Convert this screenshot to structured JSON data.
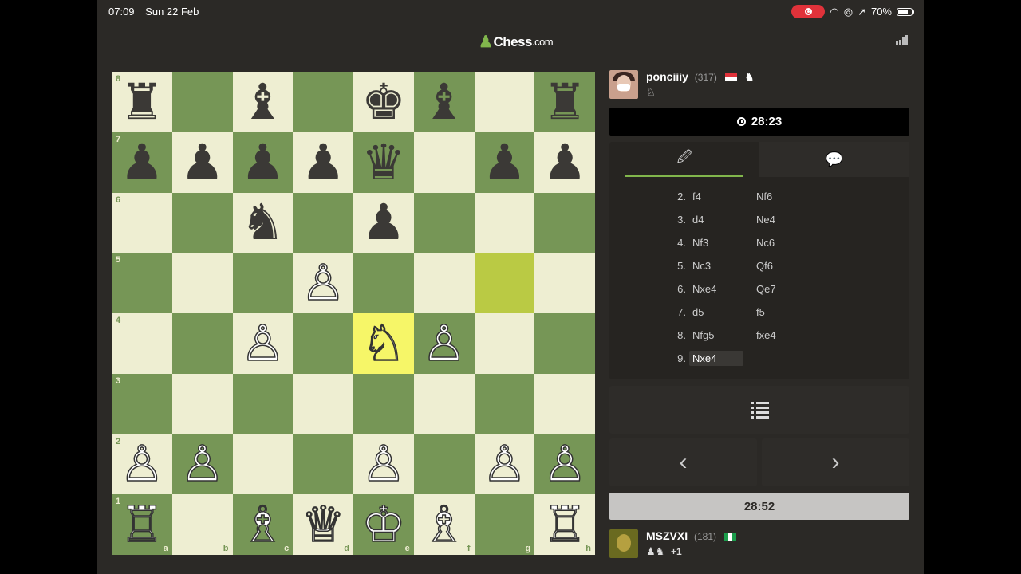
{
  "status_bar": {
    "time": "07:09",
    "date": "Sun 22 Feb",
    "battery": "70%"
  },
  "app": {
    "logo": "Chess",
    "logo_suffix": ".com"
  },
  "board": {
    "squares": [
      [
        "♜",
        "",
        "♝",
        "",
        "♚",
        "♝",
        "",
        "♜"
      ],
      [
        "♟",
        "♟",
        "♟",
        "♟",
        "♛",
        "",
        "♟",
        "♟"
      ],
      [
        "",
        "",
        "♞",
        "",
        "♟",
        "",
        "",
        ""
      ],
      [
        "",
        "",
        "",
        "♙",
        "",
        "",
        "",
        ""
      ],
      [
        "",
        "",
        "♙",
        "",
        "♘",
        "♙",
        "",
        ""
      ],
      [
        "",
        "",
        "",
        "",
        "",
        "",
        "",
        ""
      ],
      [
        "♙",
        "♙",
        "",
        "",
        "♙",
        "",
        "♙",
        "♙"
      ],
      [
        "♖",
        "",
        "♗",
        "♕",
        "♔",
        "♗",
        "",
        "♖"
      ]
    ],
    "colors": [
      [
        "b",
        "",
        "b",
        "",
        "b",
        "b",
        "",
        "b"
      ],
      [
        "b",
        "b",
        "b",
        "b",
        "b",
        "",
        "b",
        "b"
      ],
      [
        "",
        "",
        "b",
        "",
        "b",
        "",
        "",
        ""
      ],
      [
        "",
        "",
        "",
        "w",
        "",
        "",
        "",
        ""
      ],
      [
        "",
        "",
        "w",
        "",
        "w",
        "w",
        "",
        ""
      ],
      [
        "",
        "",
        "",
        "",
        "",
        "",
        "",
        ""
      ],
      [
        "w",
        "w",
        "",
        "",
        "w",
        "",
        "w",
        "w"
      ],
      [
        "w",
        "",
        "w",
        "w",
        "w",
        "w",
        "",
        "w"
      ]
    ],
    "ranks": [
      "8",
      "7",
      "6",
      "5",
      "4",
      "3",
      "2",
      "1"
    ],
    "files": [
      "a",
      "b",
      "c",
      "d",
      "e",
      "f",
      "g",
      "h"
    ],
    "highlight_from": "g5",
    "highlight_to": "e4"
  },
  "opponent": {
    "name": "ponciiiy",
    "rating": "(317)",
    "captured": "♘"
  },
  "opponent_clock": "28:23",
  "tabs": {
    "moves_icon": "🖉",
    "chat_icon": "💬"
  },
  "moves": [
    {
      "num": "2.",
      "white": "f4",
      "black": "Nf6"
    },
    {
      "num": "3.",
      "white": "d4",
      "black": "Ne4"
    },
    {
      "num": "4.",
      "white": "Nf3",
      "black": "Nc6"
    },
    {
      "num": "5.",
      "white": "Nc3",
      "black": "Qf6"
    },
    {
      "num": "6.",
      "white": "Nxe4",
      "black": "Qe7"
    },
    {
      "num": "7.",
      "white": "d5",
      "black": "f5"
    },
    {
      "num": "8.",
      "white": "Nfg5",
      "black": "fxe4"
    },
    {
      "num": "9.",
      "white": "Nxe4",
      "black": ""
    }
  ],
  "nav": {
    "prev": "‹",
    "next": "›"
  },
  "player_clock": "28:52",
  "player": {
    "name": "MSZVXI",
    "rating": "(181)",
    "captured": "♟♞",
    "advantage": "+1"
  }
}
